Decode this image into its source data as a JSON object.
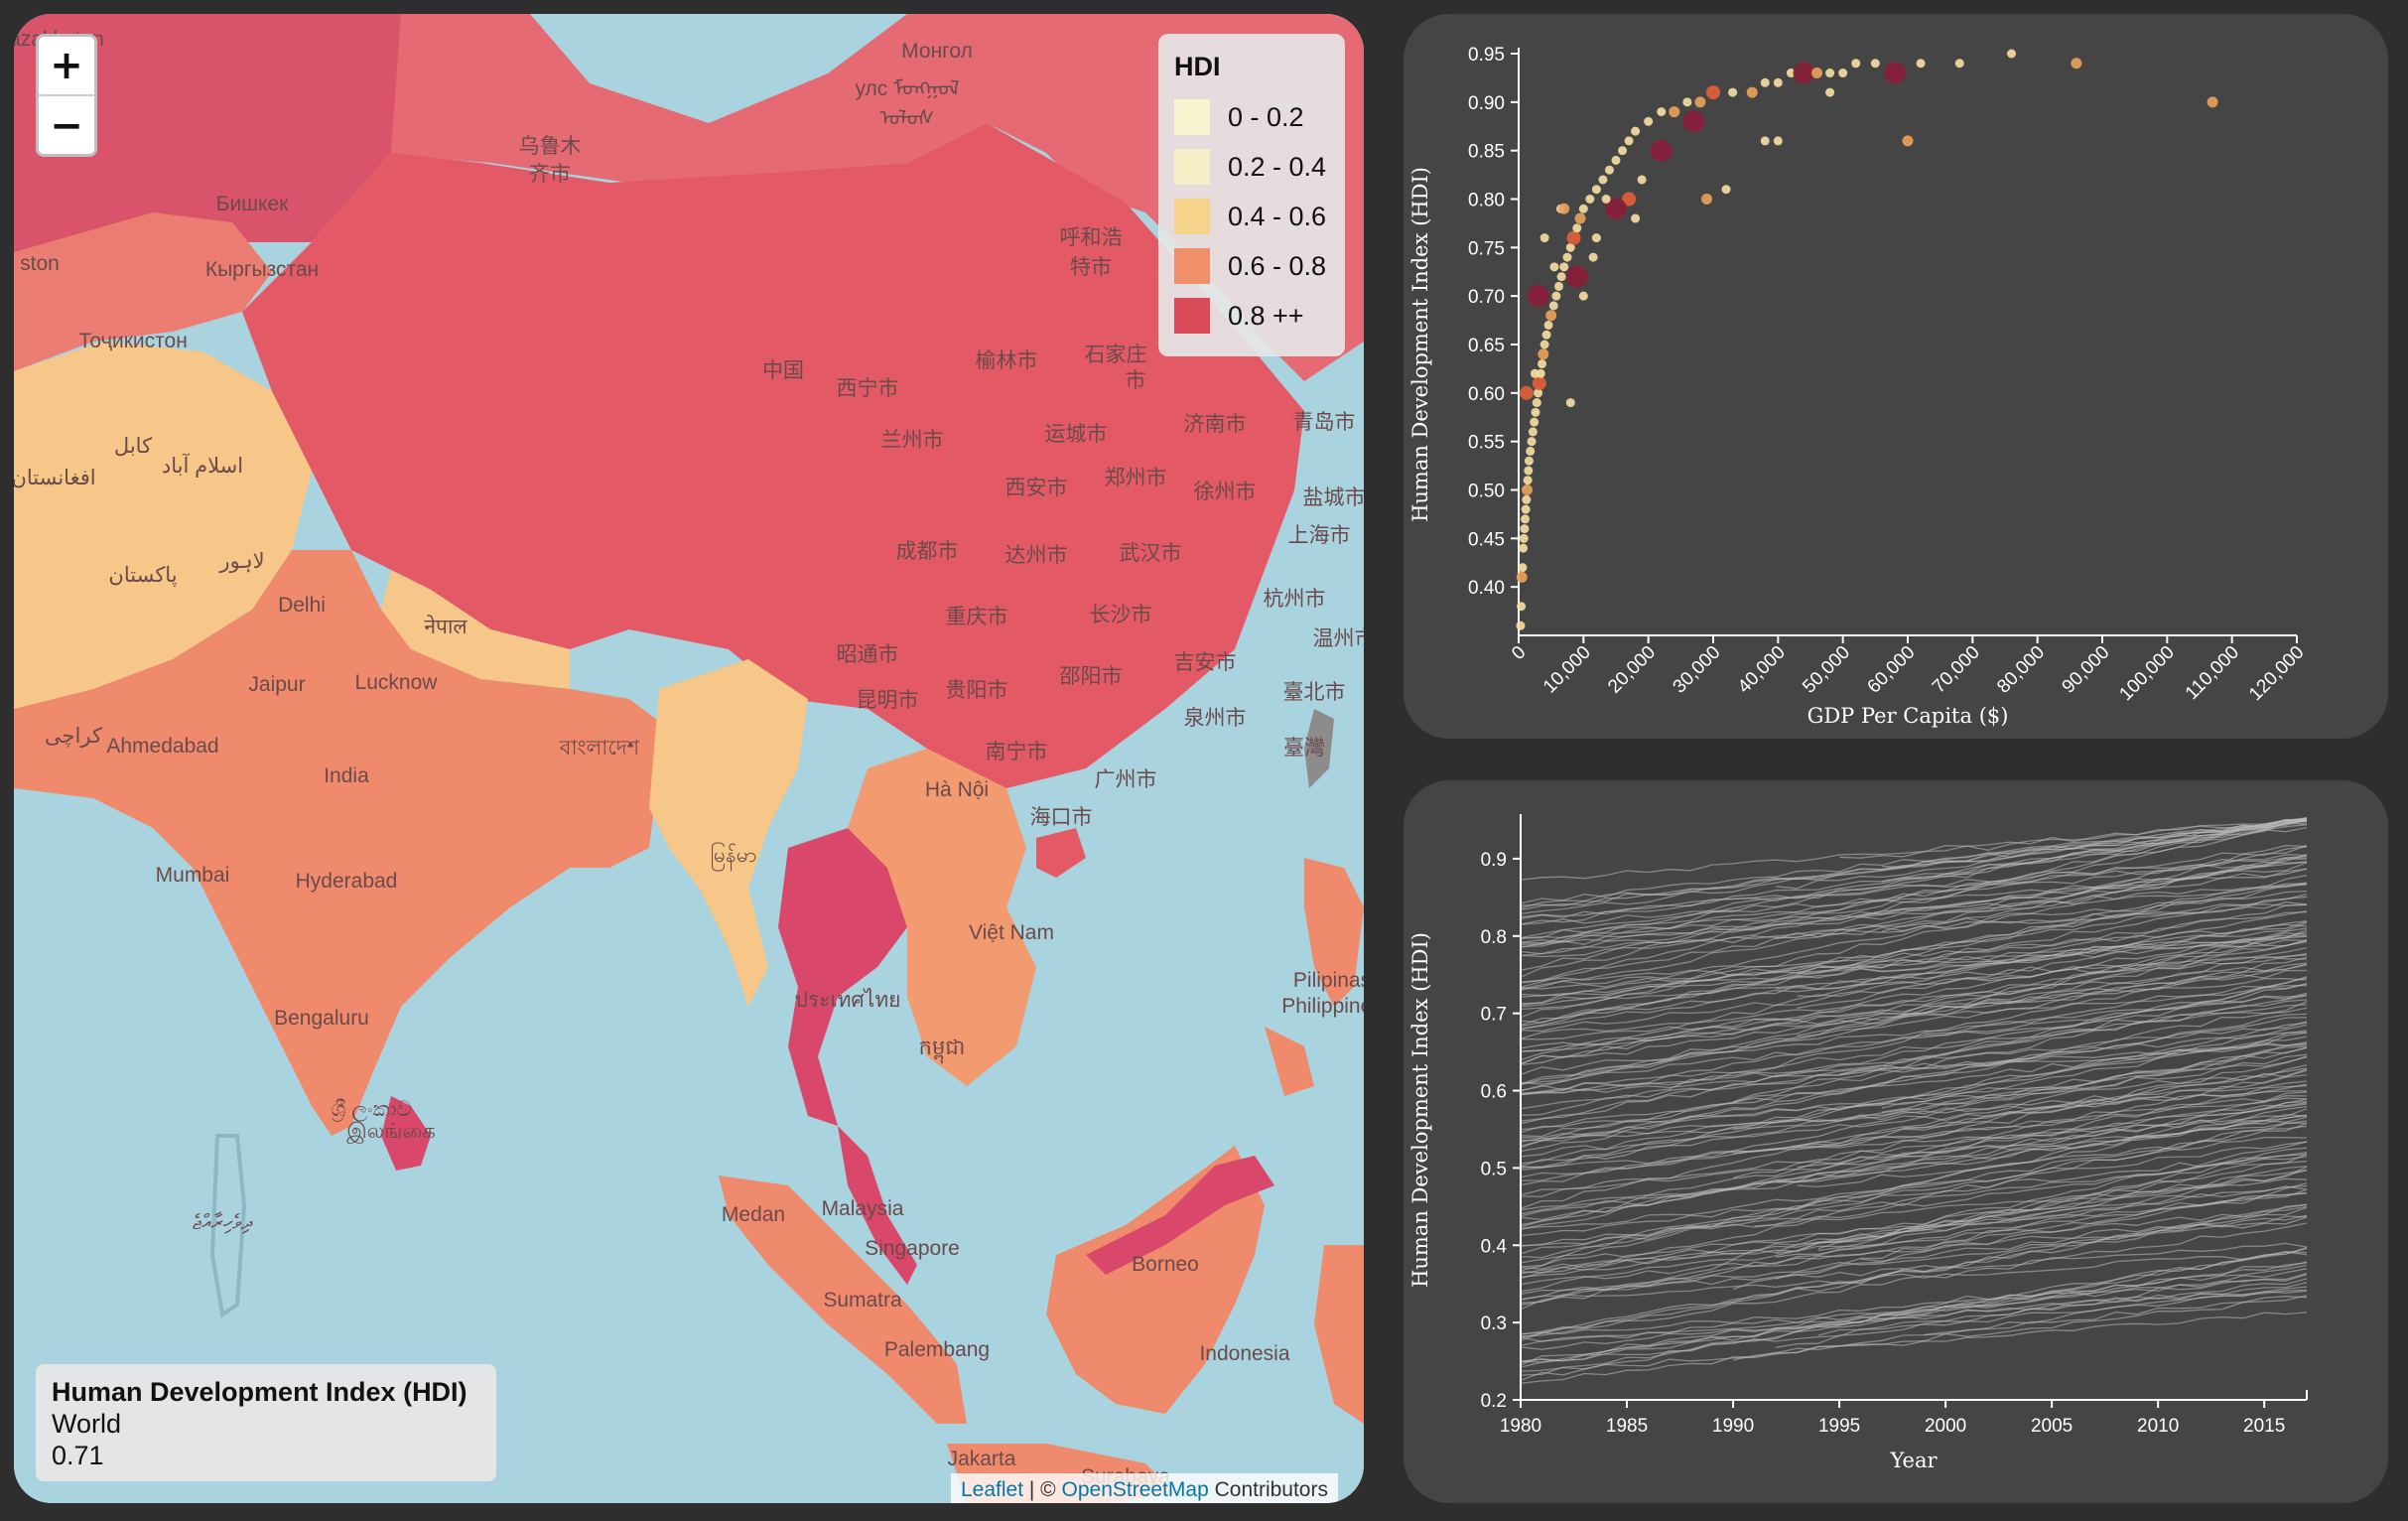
{
  "map": {
    "zoom_in": "+",
    "zoom_out": "−",
    "legend": {
      "title": "HDI",
      "items": [
        {
          "label": "0 - 0.2",
          "color": "#f7f4cf"
        },
        {
          "label": "0.2 - 0.4",
          "color": "#f6eec6"
        },
        {
          "label": "0.4 - 0.6",
          "color": "#f6d38a"
        },
        {
          "label": "0.6 - 0.8",
          "color": "#f0906a"
        },
        {
          "label": "0.8 ++",
          "color": "#d94a5a"
        }
      ]
    },
    "info": {
      "title": "Human Development Index (HDI)",
      "region": "World",
      "value": "0.71"
    },
    "attribution": {
      "leaflet": "Leaflet",
      "separator": " | © ",
      "osm": "OpenStreetMap",
      "suffix": " Contributors"
    },
    "place_labels": [
      "Монгол",
      "улс ᠮᠣᠩᠭᠣᠯ",
      "ᠤᠯᠤᠰ",
      "乌鲁木",
      "齐市",
      "Бишкек",
      "Кыргызстан",
      "Тоҷикистон",
      "呼和浩",
      "特市",
      "石家庄",
      "市",
      "中国",
      "西宁市",
      "榆林市",
      "兰州市",
      "运城市",
      "济南市",
      "青岛市",
      "西安市",
      "郑州市",
      "徐州市",
      "盐城市",
      "成都市",
      "达州市",
      "武汉市",
      "上海市",
      "杭州市",
      "重庆市",
      "长沙市",
      "温州市",
      "昭通市",
      "贵阳市",
      "邵阳市",
      "吉安市",
      "臺北市",
      "昆明市",
      "泉州市",
      "臺灣",
      "南宁市",
      "广州市",
      "Hà Nội",
      "海口市",
      "کابل",
      "اسلام آباد",
      "افغانستان",
      "پاکستان",
      "لاہور",
      "Delhi",
      "नेपाल",
      "Jaipur",
      "Lucknow",
      "کراچی",
      "Ahmedabad",
      "India",
      "বাংলাদেশ",
      "Mumbai",
      "Hyderabad",
      "မြန်မာ",
      "Việt Nam",
      "Bengaluru",
      "ประเทศไทย",
      "កម្ពុជា",
      "Pilipinas",
      "Philippines",
      "ශ්‍රී ලංකාව",
      "இலங்கை",
      "ދިވެހިރާއްޖެ",
      "Malaysia",
      "Medan",
      "Singapore",
      "Borneo",
      "Sumatra",
      "Palembang",
      "Indonesia",
      "Jakarta",
      "Surabaya",
      "Kazakhstan",
      "ston"
    ]
  },
  "chart_data": [
    {
      "type": "scatter",
      "title": "",
      "xlabel": "GDP Per Capita ($)",
      "ylabel": "Human Development Index (HDI)",
      "xlim": [
        0,
        120000
      ],
      "ylim": [
        0.35,
        0.95
      ],
      "x_ticks": [
        "0",
        "10,000",
        "20,000",
        "30,000",
        "40,000",
        "50,000",
        "60,000",
        "70,000",
        "80,000",
        "90,000",
        "100,000",
        "110,000",
        "120,000"
      ],
      "y_ticks": [
        "0.40",
        "0.45",
        "0.50",
        "0.55",
        "0.60",
        "0.65",
        "0.70",
        "0.75",
        "0.80",
        "0.85",
        "0.90",
        "0.95"
      ],
      "point_colors": {
        "low": "#f2dca0",
        "mid": "#e8a15a",
        "high": "#e0603a",
        "top": "#8a1e3a"
      },
      "points": [
        [
          300,
          0.36,
          "low"
        ],
        [
          400,
          0.38,
          "low"
        ],
        [
          500,
          0.41,
          "mid"
        ],
        [
          600,
          0.42,
          "low"
        ],
        [
          700,
          0.44,
          "low"
        ],
        [
          800,
          0.45,
          "low"
        ],
        [
          900,
          0.46,
          "low"
        ],
        [
          1000,
          0.47,
          "low"
        ],
        [
          1100,
          0.48,
          "low"
        ],
        [
          1200,
          0.49,
          "low"
        ],
        [
          1300,
          0.5,
          "mid"
        ],
        [
          1400,
          0.51,
          "low"
        ],
        [
          1500,
          0.52,
          "low"
        ],
        [
          1600,
          0.53,
          "low"
        ],
        [
          1800,
          0.54,
          "low"
        ],
        [
          2000,
          0.55,
          "low"
        ],
        [
          2200,
          0.56,
          "low"
        ],
        [
          2400,
          0.57,
          "low"
        ],
        [
          2600,
          0.58,
          "low"
        ],
        [
          2800,
          0.59,
          "low"
        ],
        [
          3000,
          0.6,
          "low"
        ],
        [
          3200,
          0.61,
          "high"
        ],
        [
          3400,
          0.62,
          "low"
        ],
        [
          3600,
          0.63,
          "low"
        ],
        [
          3800,
          0.64,
          "mid"
        ],
        [
          4000,
          0.65,
          "low"
        ],
        [
          4300,
          0.66,
          "low"
        ],
        [
          4600,
          0.67,
          "low"
        ],
        [
          5000,
          0.68,
          "mid"
        ],
        [
          5400,
          0.69,
          "low"
        ],
        [
          5800,
          0.7,
          "low"
        ],
        [
          6200,
          0.71,
          "low"
        ],
        [
          6600,
          0.72,
          "low"
        ],
        [
          7000,
          0.73,
          "low"
        ],
        [
          7500,
          0.74,
          "low"
        ],
        [
          8000,
          0.75,
          "low"
        ],
        [
          8500,
          0.76,
          "high"
        ],
        [
          9000,
          0.77,
          "low"
        ],
        [
          9500,
          0.78,
          "mid"
        ],
        [
          10000,
          0.79,
          "low"
        ],
        [
          11000,
          0.8,
          "low"
        ],
        [
          12000,
          0.81,
          "low"
        ],
        [
          13000,
          0.82,
          "low"
        ],
        [
          14000,
          0.83,
          "low"
        ],
        [
          15000,
          0.84,
          "low"
        ],
        [
          16000,
          0.85,
          "low"
        ],
        [
          17000,
          0.86,
          "low"
        ],
        [
          18000,
          0.87,
          "low"
        ],
        [
          20000,
          0.88,
          "low"
        ],
        [
          22000,
          0.89,
          "low"
        ],
        [
          24000,
          0.89,
          "mid"
        ],
        [
          26000,
          0.9,
          "low"
        ],
        [
          28000,
          0.9,
          "mid"
        ],
        [
          30000,
          0.91,
          "high"
        ],
        [
          33000,
          0.91,
          "low"
        ],
        [
          36000,
          0.91,
          "mid"
        ],
        [
          38000,
          0.92,
          "low"
        ],
        [
          40000,
          0.92,
          "low"
        ],
        [
          42000,
          0.93,
          "low"
        ],
        [
          44000,
          0.93,
          "top"
        ],
        [
          46000,
          0.93,
          "mid"
        ],
        [
          48000,
          0.93,
          "low"
        ],
        [
          50000,
          0.93,
          "low"
        ],
        [
          52000,
          0.94,
          "low"
        ],
        [
          55000,
          0.94,
          "low"
        ],
        [
          58000,
          0.93,
          "top"
        ],
        [
          62000,
          0.94,
          "low"
        ],
        [
          68000,
          0.94,
          "low"
        ],
        [
          76000,
          0.95,
          "low"
        ],
        [
          86000,
          0.94,
          "mid"
        ],
        [
          107000,
          0.9,
          "mid"
        ],
        [
          60000,
          0.86,
          "mid"
        ],
        [
          48000,
          0.91,
          "low"
        ],
        [
          40000,
          0.86,
          "low"
        ],
        [
          38000,
          0.86,
          "low"
        ],
        [
          32000,
          0.81,
          "low"
        ],
        [
          29000,
          0.8,
          "mid"
        ],
        [
          22000,
          0.85,
          "top"
        ],
        [
          27000,
          0.88,
          "top"
        ],
        [
          17000,
          0.8,
          "high"
        ],
        [
          18000,
          0.78,
          "low"
        ],
        [
          9000,
          0.72,
          "top"
        ],
        [
          3000,
          0.7,
          "top"
        ],
        [
          8000,
          0.59,
          "low"
        ],
        [
          2500,
          0.62,
          "low"
        ],
        [
          1200,
          0.6,
          "high"
        ],
        [
          15000,
          0.79,
          "top"
        ],
        [
          12000,
          0.76,
          "low"
        ],
        [
          6500,
          0.79,
          "low"
        ],
        [
          4000,
          0.76,
          "low"
        ],
        [
          5500,
          0.73,
          "low"
        ],
        [
          7000,
          0.79,
          "mid"
        ],
        [
          10000,
          0.7,
          "low"
        ],
        [
          11500,
          0.74,
          "low"
        ],
        [
          13500,
          0.8,
          "low"
        ],
        [
          19000,
          0.82,
          "low"
        ]
      ]
    },
    {
      "type": "line",
      "title": "",
      "xlabel": "Year",
      "ylabel": "Human Development Index (HDI)",
      "xlim": [
        1980,
        2017
      ],
      "ylim": [
        0.2,
        0.95
      ],
      "x_ticks": [
        "1980",
        "1985",
        "1990",
        "1995",
        "2000",
        "2005",
        "2010",
        "2015"
      ],
      "y_ticks": [
        "0.2",
        "0.3",
        "0.4",
        "0.5",
        "0.6",
        "0.7",
        "0.8",
        "0.9"
      ],
      "line_color": "#bdbdbd",
      "series_count": 170,
      "start_range": [
        0.22,
        0.86
      ],
      "end_range": [
        0.35,
        0.95
      ]
    }
  ]
}
